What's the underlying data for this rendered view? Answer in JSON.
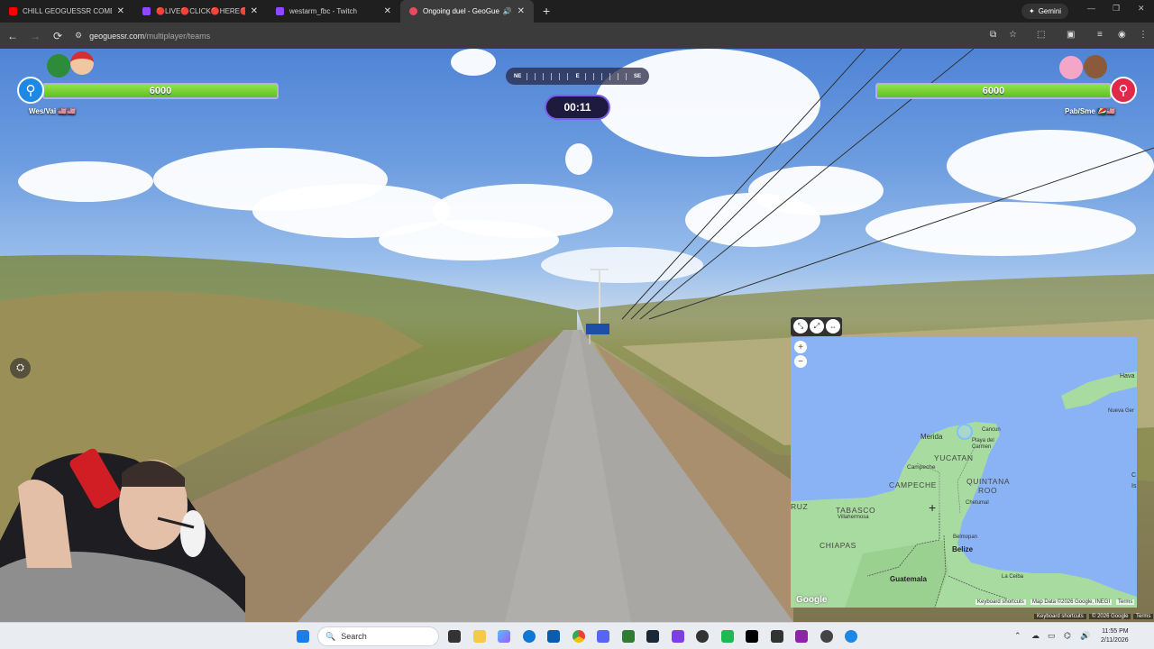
{
  "browser": {
    "tabs": [
      {
        "title": "CHILL GEOGUESSR COME AND",
        "favicon_color": "#ff0000"
      },
      {
        "title": "🔴LIVE🔴CLICK🔴HERE🔴DR",
        "favicon_color": "#9146ff"
      },
      {
        "title": "westarm_fbc - Twitch",
        "favicon_color": "#9146ff"
      },
      {
        "title": "Ongoing duel - GeoGuessr",
        "favicon_color": "#e84a5f",
        "active": true
      }
    ],
    "new_tab": "+",
    "gemini_label": "Gemini",
    "url_domain": "geoguessr.com",
    "url_path": "/multiplayer/teams"
  },
  "game": {
    "left_team": {
      "health": "6000",
      "name": "Wes/Vai 🇺🇸🇺🇸",
      "accent": "#1e88e5"
    },
    "right_team": {
      "health": "6000",
      "name": "Pab/Sme 🇸🇨🇺🇸",
      "accent": "#e0294a"
    },
    "compass": {
      "left": "NE",
      "center": "E",
      "right": "SE"
    },
    "timer": "00:11",
    "street_sign": "",
    "game_attribution": [
      "Keyboard shortcuts",
      "© 2026 Google",
      "Terms"
    ]
  },
  "map": {
    "labels": {
      "merida": "Merida",
      "cancun": "Cancun",
      "playa": "Playa del Carmen",
      "yucatan": "YUCATAN",
      "campeche_city": "Campeche",
      "campeche": "CAMPECHE",
      "quintana": "QUINTANA",
      "roo": "ROO",
      "chetumal": "Chetumal",
      "tabasco": "TABASCO",
      "villahermosa": "Villahermosa",
      "chiapas": "CHIAPAS",
      "belmopan": "Belmopan",
      "belize": "Belize",
      "guatemala": "Guatemala",
      "la_ceiba": "La Ceiba",
      "havana": "Hava",
      "nueva_gerona": "Nueva Ger",
      "ruz": "RUZ",
      "cay": "C",
      "isl": "Is"
    },
    "zoom_in": "+",
    "zoom_out": "−",
    "google": "Google",
    "attribution": [
      "Keyboard shortcuts",
      "Map Data ©2026 Google, INEGI",
      "Terms"
    ],
    "colors": {
      "water": "#8ab3f5",
      "land": "#a8dba0"
    }
  },
  "taskbar": {
    "search_placeholder": "Search",
    "time": "11:55 PM",
    "date": "2/11/2026"
  }
}
